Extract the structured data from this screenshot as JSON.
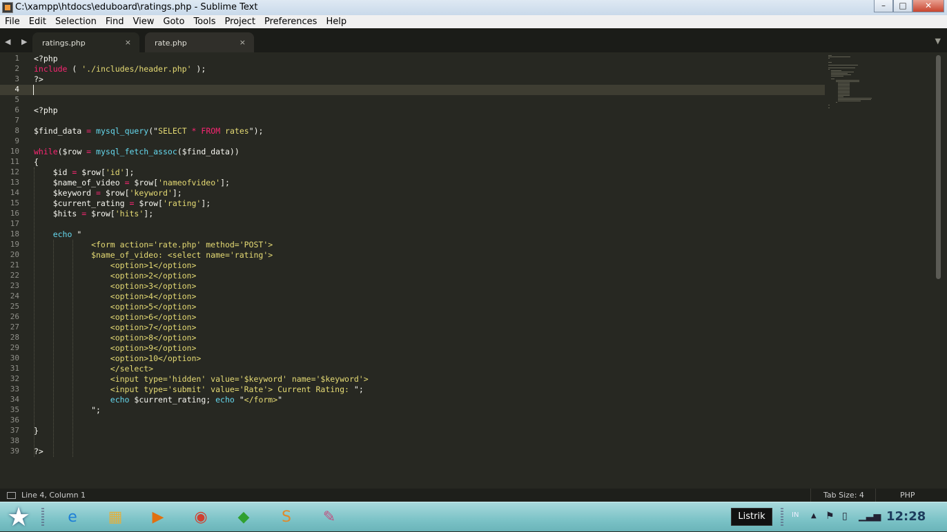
{
  "window": {
    "title": "C:\\xampp\\htdocs\\eduboard\\ratings.php - Sublime Text",
    "minimize_glyph": "–",
    "maximize_glyph": "□",
    "close_glyph": "✕"
  },
  "menu": [
    "File",
    "Edit",
    "Selection",
    "Find",
    "View",
    "Goto",
    "Tools",
    "Project",
    "Preferences",
    "Help"
  ],
  "tabs": [
    {
      "label": "ratings.php",
      "close": "×",
      "active": true
    },
    {
      "label": "rate.php",
      "close": "×",
      "active": false
    }
  ],
  "nav_arrows": "◀ ▶",
  "tab_dropdown": "▼",
  "editor": {
    "current_line": 4,
    "line_numbers": [
      "1",
      "2",
      "3",
      "4",
      "5",
      "6",
      "7",
      "8",
      "9",
      "10",
      "11",
      "12",
      "13",
      "14",
      "15",
      "16",
      "17",
      "18",
      "19",
      "20",
      "21",
      "22",
      "23",
      "24",
      "25",
      "26",
      "27",
      "28",
      "29",
      "30",
      "31",
      "32",
      "33",
      "34",
      "35",
      "36",
      "37",
      "38",
      "39"
    ],
    "lines": [
      [
        {
          "t": "<?php",
          "c": ""
        }
      ],
      [
        {
          "t": "include",
          "c": "k"
        },
        {
          "t": " ( ",
          "c": ""
        },
        {
          "t": "'./includes/header.php'",
          "c": "s"
        },
        {
          "t": " );",
          "c": ""
        }
      ],
      [
        {
          "t": "?>",
          "c": ""
        }
      ],
      [],
      [],
      [
        {
          "t": "<?php",
          "c": ""
        }
      ],
      [],
      [
        {
          "t": "$find_data ",
          "c": ""
        },
        {
          "t": "=",
          "c": "k"
        },
        {
          "t": " ",
          "c": ""
        },
        {
          "t": "mysql_query",
          "c": "f"
        },
        {
          "t": "(\"",
          "c": ""
        },
        {
          "t": "SELECT ",
          "c": "s"
        },
        {
          "t": "*",
          "c": "k"
        },
        {
          "t": " ",
          "c": "s"
        },
        {
          "t": "FROM",
          "c": "k"
        },
        {
          "t": " rates",
          "c": "s"
        },
        {
          "t": "\");",
          "c": ""
        }
      ],
      [],
      [
        {
          "t": "while",
          "c": "k"
        },
        {
          "t": "($row ",
          "c": ""
        },
        {
          "t": "=",
          "c": "k"
        },
        {
          "t": " ",
          "c": ""
        },
        {
          "t": "mysql_fetch_assoc",
          "c": "f"
        },
        {
          "t": "($find_data))",
          "c": ""
        }
      ],
      [
        {
          "t": "{",
          "c": ""
        }
      ],
      [
        {
          "t": "    $id ",
          "c": ""
        },
        {
          "t": "=",
          "c": "k"
        },
        {
          "t": " $row[",
          "c": ""
        },
        {
          "t": "'id'",
          "c": "s"
        },
        {
          "t": "];",
          "c": ""
        }
      ],
      [
        {
          "t": "    $name_of_video ",
          "c": ""
        },
        {
          "t": "=",
          "c": "k"
        },
        {
          "t": " $row[",
          "c": ""
        },
        {
          "t": "'nameofvideo'",
          "c": "s"
        },
        {
          "t": "];",
          "c": ""
        }
      ],
      [
        {
          "t": "    $keyword ",
          "c": ""
        },
        {
          "t": "=",
          "c": "k"
        },
        {
          "t": " $row[",
          "c": ""
        },
        {
          "t": "'keyword'",
          "c": "s"
        },
        {
          "t": "];",
          "c": ""
        }
      ],
      [
        {
          "t": "    $current_rating ",
          "c": ""
        },
        {
          "t": "=",
          "c": "k"
        },
        {
          "t": " $row[",
          "c": ""
        },
        {
          "t": "'rating'",
          "c": "s"
        },
        {
          "t": "];",
          "c": ""
        }
      ],
      [
        {
          "t": "    $hits ",
          "c": ""
        },
        {
          "t": "=",
          "c": "k"
        },
        {
          "t": " $row[",
          "c": ""
        },
        {
          "t": "'hits'",
          "c": "s"
        },
        {
          "t": "];",
          "c": ""
        }
      ],
      [],
      [
        {
          "t": "    ",
          "c": ""
        },
        {
          "t": "echo",
          "c": "f"
        },
        {
          "t": " \"",
          "c": ""
        }
      ],
      [
        {
          "t": "            <form action='rate.php' method='POST'>",
          "c": "s"
        }
      ],
      [
        {
          "t": "            $name_of_video: <select name='rating'>",
          "c": "s"
        }
      ],
      [
        {
          "t": "                <option>1</option>",
          "c": "s"
        }
      ],
      [
        {
          "t": "                <option>2</option>",
          "c": "s"
        }
      ],
      [
        {
          "t": "                <option>3</option>",
          "c": "s"
        }
      ],
      [
        {
          "t": "                <option>4</option>",
          "c": "s"
        }
      ],
      [
        {
          "t": "                <option>5</option>",
          "c": "s"
        }
      ],
      [
        {
          "t": "                <option>6</option>",
          "c": "s"
        }
      ],
      [
        {
          "t": "                <option>7</option>",
          "c": "s"
        }
      ],
      [
        {
          "t": "                <option>8</option>",
          "c": "s"
        }
      ],
      [
        {
          "t": "                <option>9</option>",
          "c": "s"
        }
      ],
      [
        {
          "t": "                <option>10</option>",
          "c": "s"
        }
      ],
      [
        {
          "t": "                </select>",
          "c": "s"
        }
      ],
      [
        {
          "t": "                <input type='hidden' value='$keyword' name='$keyword'>",
          "c": "s"
        }
      ],
      [
        {
          "t": "                <input type='submit' value='Rate'> Current Rating: ",
          "c": "s"
        },
        {
          "t": "\";",
          "c": ""
        }
      ],
      [
        {
          "t": "                ",
          "c": ""
        },
        {
          "t": "echo",
          "c": "f"
        },
        {
          "t": " $current_rating; ",
          "c": ""
        },
        {
          "t": "echo",
          "c": "f"
        },
        {
          "t": " \"",
          "c": ""
        },
        {
          "t": "</form>",
          "c": "s"
        },
        {
          "t": "\"",
          "c": ""
        }
      ],
      [
        {
          "t": "            \";",
          "c": ""
        }
      ],
      [],
      [
        {
          "t": "}",
          "c": ""
        }
      ],
      [],
      [
        {
          "t": "?>",
          "c": ""
        }
      ]
    ]
  },
  "status": {
    "position": "Line 4, Column 1",
    "tab_size": "Tab Size: 4",
    "syntax": "PHP"
  },
  "taskbar": {
    "start_glyph": "★",
    "apps": [
      {
        "name": "internet-explorer-icon",
        "glyph": "e",
        "color": "#1e7fd6"
      },
      {
        "name": "file-explorer-icon",
        "glyph": "▦",
        "color": "#e0b040"
      },
      {
        "name": "media-player-icon",
        "glyph": "▶",
        "color": "#e07010"
      },
      {
        "name": "chrome-icon",
        "glyph": "◉",
        "color": "#d04030"
      },
      {
        "name": "download-manager-icon",
        "glyph": "◆",
        "color": "#30a030"
      },
      {
        "name": "sublime-text-icon",
        "glyph": "S",
        "color": "#e08a2a"
      },
      {
        "name": "paint-icon",
        "glyph": "✎",
        "color": "#c05080"
      }
    ],
    "tooltip": "Listrik",
    "language": "IN",
    "clock": "12:28"
  }
}
